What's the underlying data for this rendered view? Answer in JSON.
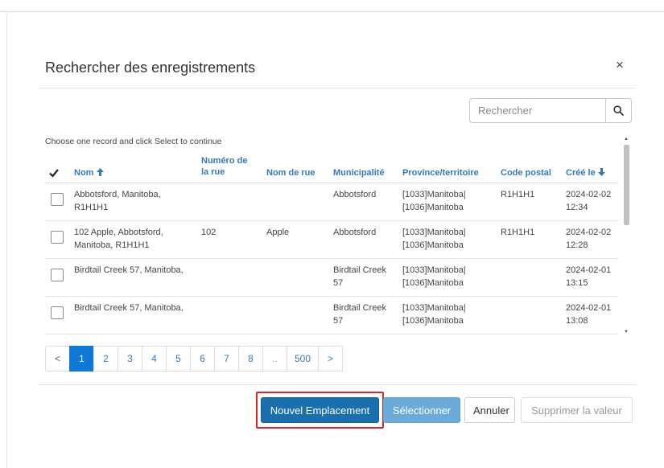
{
  "dialog": {
    "title": "Rechercher des enregistrements",
    "close_label": "×"
  },
  "search": {
    "placeholder": "Rechercher",
    "icon": "search-icon"
  },
  "instruction": "Choose one record and click Select to continue",
  "table": {
    "headers": {
      "nom": "Nom",
      "numero_line1": "Numéro de",
      "numero_line2": "la rue",
      "nom_rue": "Nom de rue",
      "municipalite": "Municipalité",
      "province": "Province/territoire",
      "code_postal": "Code postal",
      "cree_le": "Créé le"
    },
    "rows": [
      {
        "nom": [
          "Abbotsford, Manitoba,",
          "R1H1H1"
        ],
        "numero": "",
        "nom_rue": "",
        "municipalite": [
          "Abbotsford",
          ""
        ],
        "province": [
          "[1033]Manitoba|",
          "[1036]Manitoba"
        ],
        "code_postal": "R1H1H1",
        "cree_le": [
          "2024-02-02",
          "12:34"
        ]
      },
      {
        "nom": [
          "102 Apple, Abbotsford,",
          "Manitoba, R1H1H1"
        ],
        "numero": "102",
        "nom_rue": "Apple",
        "municipalite": [
          "Abbotsford",
          ""
        ],
        "province": [
          "[1033]Manitoba|",
          "[1036]Manitoba"
        ],
        "code_postal": "R1H1H1",
        "cree_le": [
          "2024-02-02",
          "12:28"
        ]
      },
      {
        "nom": [
          "Birdtail Creek 57, Manitoba,",
          ""
        ],
        "numero": "",
        "nom_rue": "",
        "municipalite": [
          "Birdtail Creek",
          "57"
        ],
        "province": [
          "[1033]Manitoba|",
          "[1036]Manitoba"
        ],
        "code_postal": "",
        "cree_le": [
          "2024-02-01",
          "13:15"
        ]
      },
      {
        "nom": [
          "Birdtail Creek 57, Manitoba,",
          ""
        ],
        "numero": "",
        "nom_rue": "",
        "municipalite": [
          "Birdtail Creek",
          "57"
        ],
        "province": [
          "[1033]Manitoba|",
          "[1036]Manitoba"
        ],
        "code_postal": "",
        "cree_le": [
          "2024-02-01",
          "13:08"
        ]
      }
    ]
  },
  "pagination": {
    "prev": "<",
    "pages": [
      "1",
      "2",
      "3",
      "4",
      "5",
      "6",
      "7",
      "8",
      "..",
      "500"
    ],
    "active": "1",
    "next": ">"
  },
  "buttons": {
    "new_location": "Nouvel Emplacement",
    "select": "Sélectionner",
    "cancel": "Annuler",
    "clear_value": "Supprimer la valeur"
  },
  "colors": {
    "link_blue": "#337ab7",
    "primary_dark": "#1a6fae",
    "primary_light": "#6aabd9",
    "active_page": "#0d78d6",
    "highlight_red": "#d9282f"
  }
}
